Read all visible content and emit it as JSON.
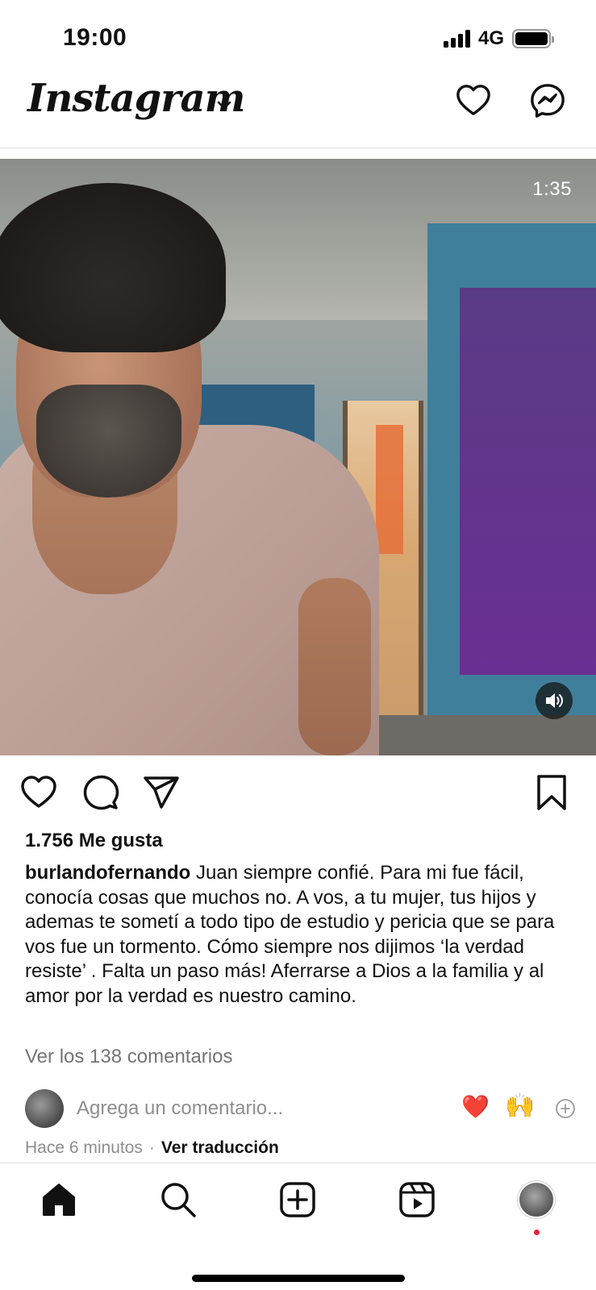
{
  "status_bar": {
    "time": "19:00",
    "network": "4G",
    "battery_level": 0.95
  },
  "header": {
    "logo_text": "Instagram"
  },
  "video": {
    "duration": "1:35"
  },
  "post": {
    "likes": "1.756 Me gusta",
    "username": "burlandofernando",
    "caption": "Juan siempre confié. Para mi fue fácil, conocía cosas que muchos no. A vos, a tu mujer, tus hijos y ademas te sometí a todo tipo de estudio y pericia que se para vos fue un tormento. Cómo siempre nos dijimos ‘la verdad resiste’ . Falta un paso más! Aferrarse a Dios a la familia y al amor por la verdad es nuestro camino.",
    "view_comments": "Ver los 138 comentarios",
    "add_comment_placeholder": "Agrega un comentario...",
    "quick_reactions": [
      "❤️",
      "🙌"
    ],
    "timestamp": "Hace 6 minutos",
    "separator": "·",
    "translate": "Ver traducción"
  },
  "icons": {
    "header": [
      "heart-icon",
      "messenger-icon",
      "chevron-down-icon"
    ],
    "actions": [
      "heart-icon",
      "comment-icon",
      "share-icon",
      "bookmark-icon"
    ],
    "nav": [
      "home-icon",
      "search-icon",
      "create-icon",
      "reels-icon",
      "profile-avatar"
    ]
  },
  "colors": {
    "notification_dot": "#ed1c3c",
    "secondary_text": "#8e8e8e"
  }
}
